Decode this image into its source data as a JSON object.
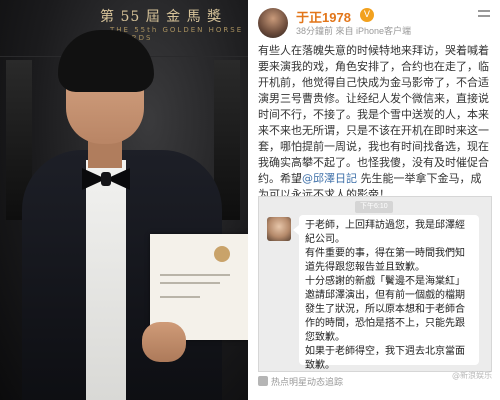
{
  "photo": {
    "banner_title": "第 55 屆 金 馬 獎",
    "banner_subtitle": "THE 55th GOLDEN HORSE AWARDS"
  },
  "post": {
    "author": "于正1978",
    "vip_badge": "V",
    "meta": "38分鐘前  來自 iPhone客户端",
    "text_before_mention": "有些人在落魄失意的时候特地来拜访，哭着喊着要来演我的戏，角色安排了，合约也在走了，临开机前，他觉得自己快成为金马影帝了，不合适演男三号曹贵修。让经纪人发个微信来，直接说时间不行，不接了。我是个雪中送炭的人，本来来不来也无所谓，只是不该在开机在即时来这一套，哪怕提前一周说，我也有时间找备选，现在我确实高攀不起了。也怪我傻，没有及时催促合约。希望",
    "mention": "@邱澤日記",
    "text_after_mention": " 先生能一举拿下金马，成为可以永远不求人的影帝！"
  },
  "chat": {
    "time_label": "下午6:10",
    "paragraphs": [
      "于老師，上回拜訪過您，我是邱澤經紀公司。",
      "有件重要的事，得在第一時間我們知道先得跟您報告並且致歉。",
      "十分感謝的新戲「鬢邊不是海棠紅」邀請邱澤演出，但有前一個戲的檔期發生了狀況，所以原本想和于老師合作的時間，恐怕是搭不上，只能先跟您致歉。",
      "如果于老師得空，我下週去北京當面致歉。"
    ]
  },
  "footer": {
    "hot_label": "热点明星动态追踪"
  },
  "watermark": "@新浪娱乐"
}
